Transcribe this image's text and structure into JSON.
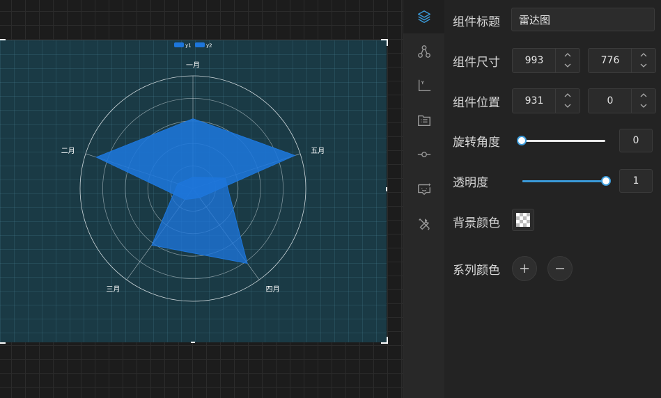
{
  "canvas": {
    "chart_data": {
      "type": "radar",
      "indicators": [
        "一月",
        "五月",
        "四月",
        "三月",
        "二月"
      ],
      "max": 100,
      "series": [
        {
          "name": "y1",
          "values": [
            62,
            95,
            10,
            12,
            90
          ],
          "color": "#1d76db"
        },
        {
          "name": "y2",
          "values": [
            10,
            30,
            82,
            62,
            14
          ],
          "color": "#1d76db"
        }
      ],
      "legend": {
        "position": "top-center",
        "items": [
          "y1",
          "y2"
        ]
      },
      "grid": true
    }
  },
  "sidebar": {
    "tools": [
      {
        "icon": "layers-icon",
        "active": true
      },
      {
        "icon": "nodes-icon",
        "active": false
      },
      {
        "icon": "axis-icon",
        "active": false
      },
      {
        "icon": "list-icon",
        "active": false
      },
      {
        "icon": "point-line-icon",
        "active": false
      },
      {
        "icon": "tooltip-icon",
        "active": false
      },
      {
        "icon": "tools-icon",
        "active": false
      }
    ],
    "accent_color": "#3a9ad9",
    "icon_color": "#9a9a9a"
  },
  "props": {
    "title_label": "组件标题",
    "title_value": "雷达图",
    "size_label": "组件尺寸",
    "width": "993",
    "height": "776",
    "position_label": "组件位置",
    "x": "931",
    "y": "0",
    "rotation_label": "旋转角度",
    "rotation": {
      "value": "0",
      "fraction": 0
    },
    "opacity_label": "透明度",
    "opacity": {
      "value": "1",
      "fraction": 1
    },
    "bg_color_label": "背景颜色",
    "series_color_label": "系列颜色"
  }
}
